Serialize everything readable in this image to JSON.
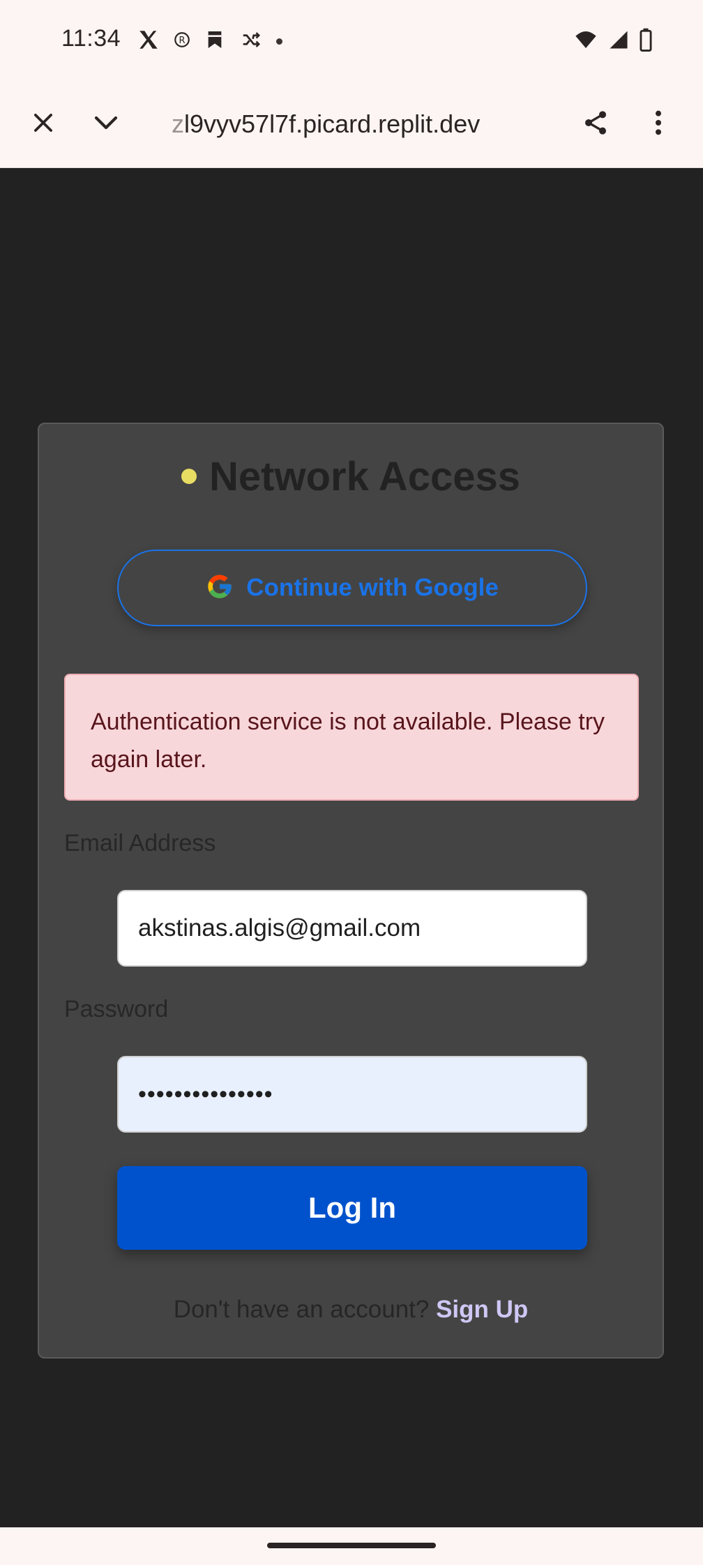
{
  "status_bar": {
    "time": "11:34",
    "left_icons": [
      "x-logo-icon",
      "registered-icon",
      "bookmark-icon",
      "shuffle-icon",
      "dot-icon"
    ],
    "right_icons": [
      "wifi-icon",
      "signal-icon",
      "battery-icon"
    ]
  },
  "browser": {
    "url_faded": "z",
    "url": "l9vyv57l7f.picard.replit.dev",
    "close_icon": "close-icon",
    "collapse_icon": "chevron-down-icon",
    "share_icon": "share-icon",
    "menu_icon": "more-vert-icon"
  },
  "card": {
    "title": "Network Access",
    "title_dot_color": "#e7dd63",
    "google_button": "Continue with Google",
    "error_message": "Authentication service is not available. Please try again later.",
    "email_label": "Email Address",
    "email_value": "akstinas.algis@gmail.com",
    "password_label": "Password",
    "password_value": "•••••••••••••••",
    "login_button": "Log In",
    "signup_prompt": "Don't have an account?",
    "signup_link": "Sign Up"
  },
  "colors": {
    "background": "#222222",
    "card": "#444444",
    "primary": "#0052cc",
    "google_blue": "#1a73e8",
    "error_bg": "#f8d7da",
    "error_text": "#58151c",
    "link": "#cfc8f5"
  }
}
